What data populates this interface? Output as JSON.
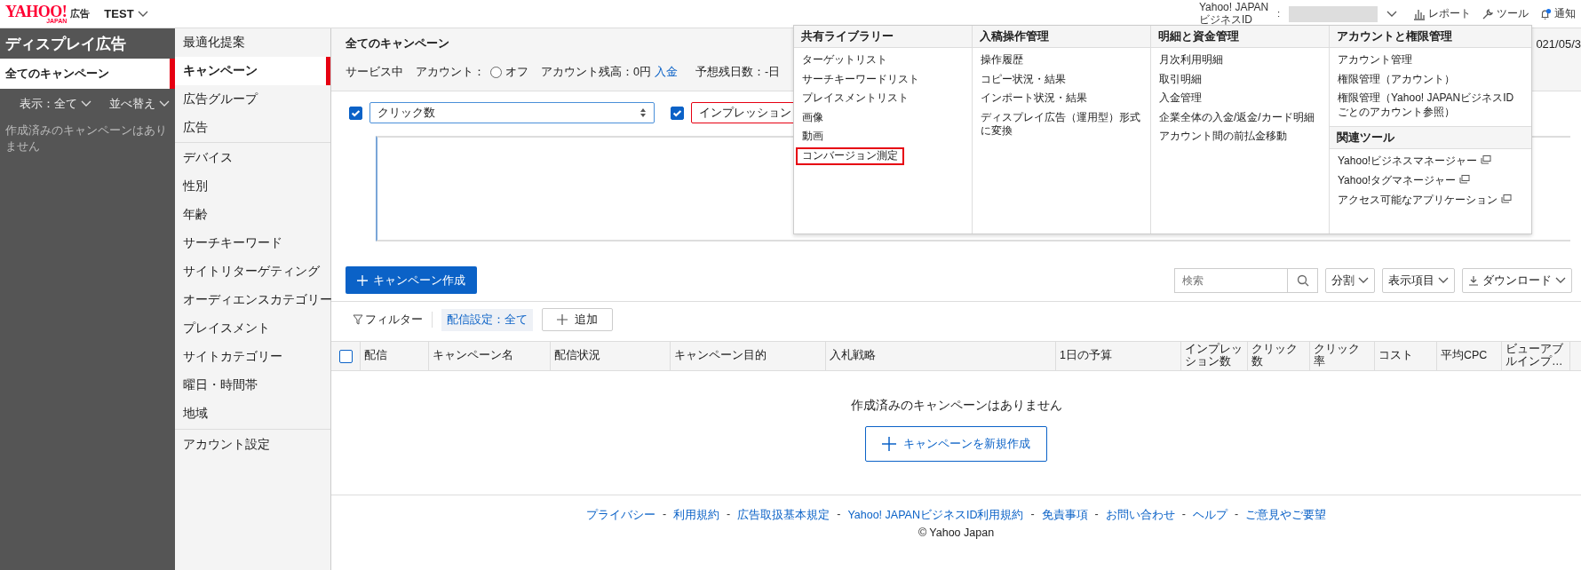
{
  "header": {
    "logo": "YAHOO!",
    "logo_sub": "JAPAN",
    "product": "広告",
    "account": "TEST",
    "business_id_label": [
      "Yahoo! JAPAN",
      "ビジネスID"
    ],
    "separator": ":",
    "tools": [
      {
        "kind": "report",
        "label": "レポート"
      },
      {
        "kind": "tool",
        "label": "ツール"
      },
      {
        "kind": "notice",
        "label": "通知",
        "unread": true
      }
    ]
  },
  "sidebar": {
    "title": "ディスプレイ広告",
    "items": [
      {
        "label": "全てのキャンペーン",
        "selected": true
      }
    ],
    "view_filter": "表示：全て",
    "sort": "並べ替え",
    "empty_text": "作成済みのキャンペーンはありません"
  },
  "nav": {
    "groups": [
      [
        {
          "label": "最適化提案",
          "selected": false
        },
        {
          "label": "キャンペーン",
          "selected": true
        },
        {
          "label": "広告グループ",
          "selected": false
        },
        {
          "label": "広告",
          "selected": false
        }
      ],
      [
        {
          "label": "デバイス",
          "selected": false
        },
        {
          "label": "性別",
          "selected": false
        },
        {
          "label": "年齢",
          "selected": false
        },
        {
          "label": "サーチキーワード",
          "selected": false
        },
        {
          "label": "サイトリターゲティング",
          "selected": false
        },
        {
          "label": "オーディエンスカテゴリー",
          "selected": false
        },
        {
          "label": "プレイスメント",
          "selected": false
        },
        {
          "label": "サイトカテゴリー",
          "selected": false
        },
        {
          "label": "曜日・時間帯",
          "selected": false
        },
        {
          "label": "地域",
          "selected": false
        }
      ],
      [
        {
          "label": "アカウント設定",
          "selected": false
        }
      ]
    ]
  },
  "main": {
    "title": "全てのキャンペーン",
    "date": "021/05/3",
    "status": {
      "service": "サービス中",
      "account_label": "アカウント：",
      "switch_label": "オフ",
      "switch_on": false,
      "balance": "アカウント残高：0円",
      "deposit_link": "入金",
      "days": "予想残日数：-日"
    },
    "metrics": [
      {
        "checked": true,
        "value": "クリック数",
        "error": false
      },
      {
        "checked": true,
        "value": "インプレッション",
        "error": true
      }
    ],
    "create_button": "キャンペーン作成",
    "search": {
      "placeholder": "検索"
    },
    "toolbar": [
      {
        "kind": "menu",
        "label": "分割"
      },
      {
        "kind": "menu",
        "label": "表示項目"
      },
      {
        "kind": "download",
        "label": "ダウンロード"
      }
    ],
    "filter_label": "フィルター",
    "filter_chip": "配信設定：全て",
    "add_button": "追加",
    "table": {
      "all_checked": false,
      "columns": [
        "配信",
        "キャンペーン名",
        "配信状況",
        "キャンペーン目的",
        "入札戦略",
        "1日の予算",
        "インプレッション数",
        "クリック数",
        "クリック率",
        "コスト",
        "平均CPC",
        "ビューアブルインプ…"
      ]
    },
    "empty_message": "作成済みのキャンペーンはありません",
    "new_campaign_button": "キャンペーンを新規作成"
  },
  "menu": {
    "columns": [
      {
        "title": "共有ライブラリー",
        "items": [
          {
            "label": "ターゲットリスト",
            "highlighted": false
          },
          {
            "label": "サーチキーワードリスト",
            "highlighted": false
          },
          {
            "label": "プレイスメントリスト",
            "highlighted": false
          },
          {
            "label": "画像",
            "highlighted": false
          },
          {
            "label": "動画",
            "highlighted": false
          },
          {
            "label": "コンバージョン測定",
            "highlighted": true
          }
        ]
      },
      {
        "title": "入稿操作管理",
        "items": [
          {
            "label": "操作履歴",
            "highlighted": false
          },
          {
            "label": "コピー状況・結果",
            "highlighted": false
          },
          {
            "label": "インポート状況・結果",
            "highlighted": false
          },
          {
            "label": "ディスプレイ広告（運用型）形式に変換",
            "highlighted": false
          }
        ]
      },
      {
        "title": "明細と資金管理",
        "items": [
          {
            "label": "月次利用明細",
            "highlighted": false
          },
          {
            "label": "取引明細",
            "highlighted": false
          },
          {
            "label": "入金管理",
            "highlighted": false
          },
          {
            "label": "企業全体の入金/返金/カード明細",
            "highlighted": false
          },
          {
            "label": "アカウント間の前払金移動",
            "highlighted": false
          }
        ]
      },
      {
        "title": "アカウントと権限管理",
        "items": [
          {
            "label": "アカウント管理",
            "highlighted": false
          },
          {
            "label": "権限管理（アカウント）",
            "highlighted": false
          },
          {
            "label": "権限管理（Yahoo! JAPANビジネスIDごとのアカウント参照）",
            "highlighted": false
          }
        ]
      },
      {
        "title": "関連ツール",
        "items": [
          {
            "label": "Yahoo!ビジネスマネージャー",
            "highlighted": false,
            "external": true
          },
          {
            "label": "Yahoo!タグマネージャー",
            "highlighted": false,
            "external": true
          },
          {
            "label": "アクセス可能なアプリケーション",
            "highlighted": false,
            "external": true
          }
        ]
      }
    ]
  },
  "footer": {
    "links": [
      "プライバシー",
      "利用規約",
      "広告取扱基本規定",
      "Yahoo! JAPANビジネスID利用規約",
      "免責事項",
      "お問い合わせ",
      "ヘルプ",
      "ご意見やご要望"
    ],
    "separator": "-",
    "copyright": "© Yahoo Japan"
  }
}
